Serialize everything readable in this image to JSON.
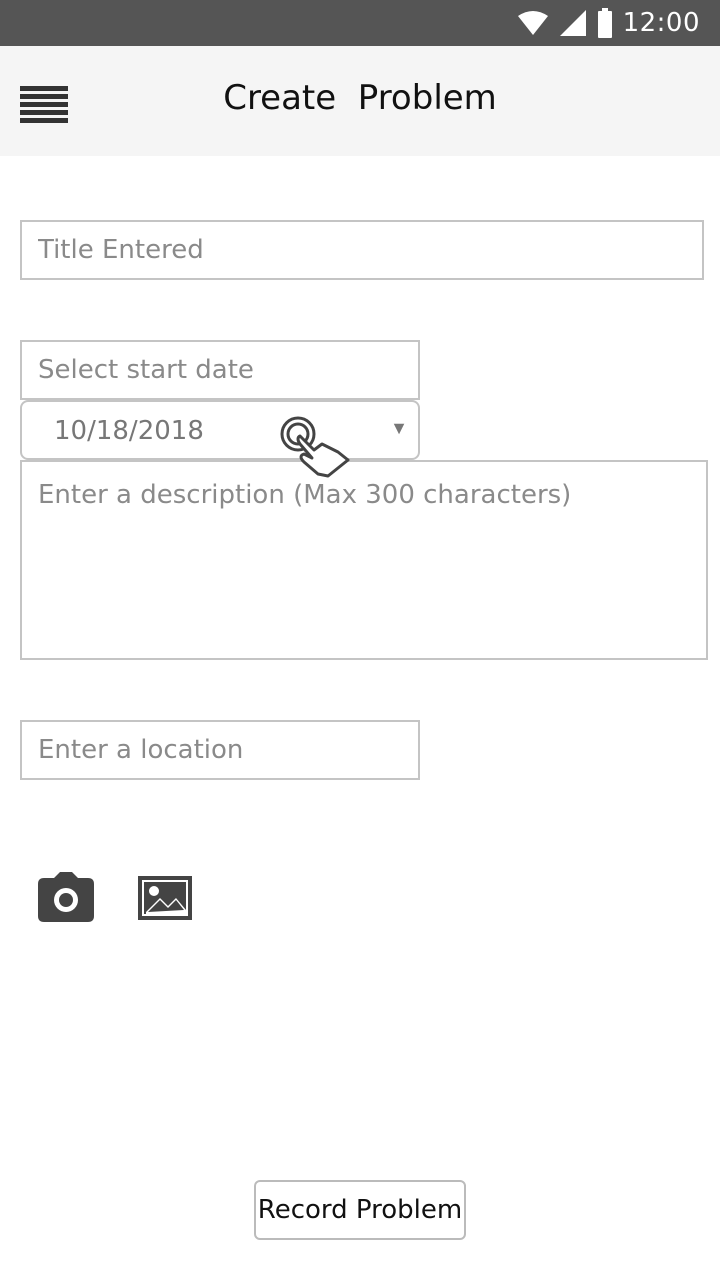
{
  "status_bar": {
    "time": "12:00",
    "icons": [
      "wifi-icon",
      "signal-icon",
      "battery-icon"
    ]
  },
  "app_bar": {
    "title": "Create  Problem",
    "menu_icon": "hamburger-menu-icon"
  },
  "form": {
    "title_field": {
      "value": "",
      "placeholder": "Title Entered"
    },
    "start_date_field": {
      "value": "",
      "placeholder": "Select start date"
    },
    "date_select": {
      "selected": "10/18/2018",
      "arrow_icon": "triangle-down-icon"
    },
    "description_field": {
      "value": "",
      "placeholder": "Enter a description (Max 300 characters)"
    },
    "location_field": {
      "value": "",
      "placeholder": "Enter a location"
    }
  },
  "media": {
    "camera_icon": "camera-icon",
    "gallery_icon": "image-gallery-icon"
  },
  "actions": {
    "record_label": "Record Problem"
  },
  "colors": {
    "status_bar": "#555555",
    "app_bar": "#f5f5f5",
    "border": "#c4c4c4",
    "icon": "#444444"
  }
}
